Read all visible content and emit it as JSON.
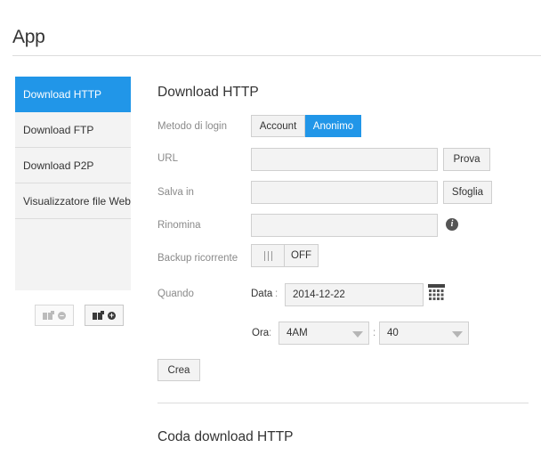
{
  "app": {
    "title": "App"
  },
  "sidebar": {
    "items": [
      {
        "label": "Download HTTP",
        "active": true
      },
      {
        "label": "Download FTP",
        "active": false
      },
      {
        "label": "Download P2P",
        "active": false
      },
      {
        "label": "Visualizzatore file Web",
        "active": false
      }
    ],
    "remove_button_icon": "remove-app-icon",
    "add_button_icon": "add-app-icon"
  },
  "form": {
    "title": "Download HTTP",
    "login_method": {
      "label": "Metodo di login",
      "options": [
        "Account",
        "Anonimo"
      ],
      "selected": "Anonimo"
    },
    "url": {
      "label": "URL",
      "value": "",
      "button": "Prova"
    },
    "save_in": {
      "label": "Salva in",
      "value": "",
      "button": "Sfoglia"
    },
    "rename": {
      "label": "Rinomina",
      "value": "",
      "info_icon": "info-icon"
    },
    "recurring_backup": {
      "label": "Backup ricorrente",
      "state": "OFF"
    },
    "when": {
      "label": "Quando",
      "date_label": "Data",
      "separator": ":",
      "date_value": "2014-12-22",
      "calendar_icon": "calendar-icon",
      "time_label": "Ora",
      "hour_value": "4AM",
      "minute_value": "40"
    },
    "create_button": "Crea"
  },
  "queue": {
    "title": "Coda download HTTP"
  },
  "colors": {
    "accent": "#2196e8",
    "field_bg": "#f3f3f3",
    "border": "#d0d0d0"
  }
}
